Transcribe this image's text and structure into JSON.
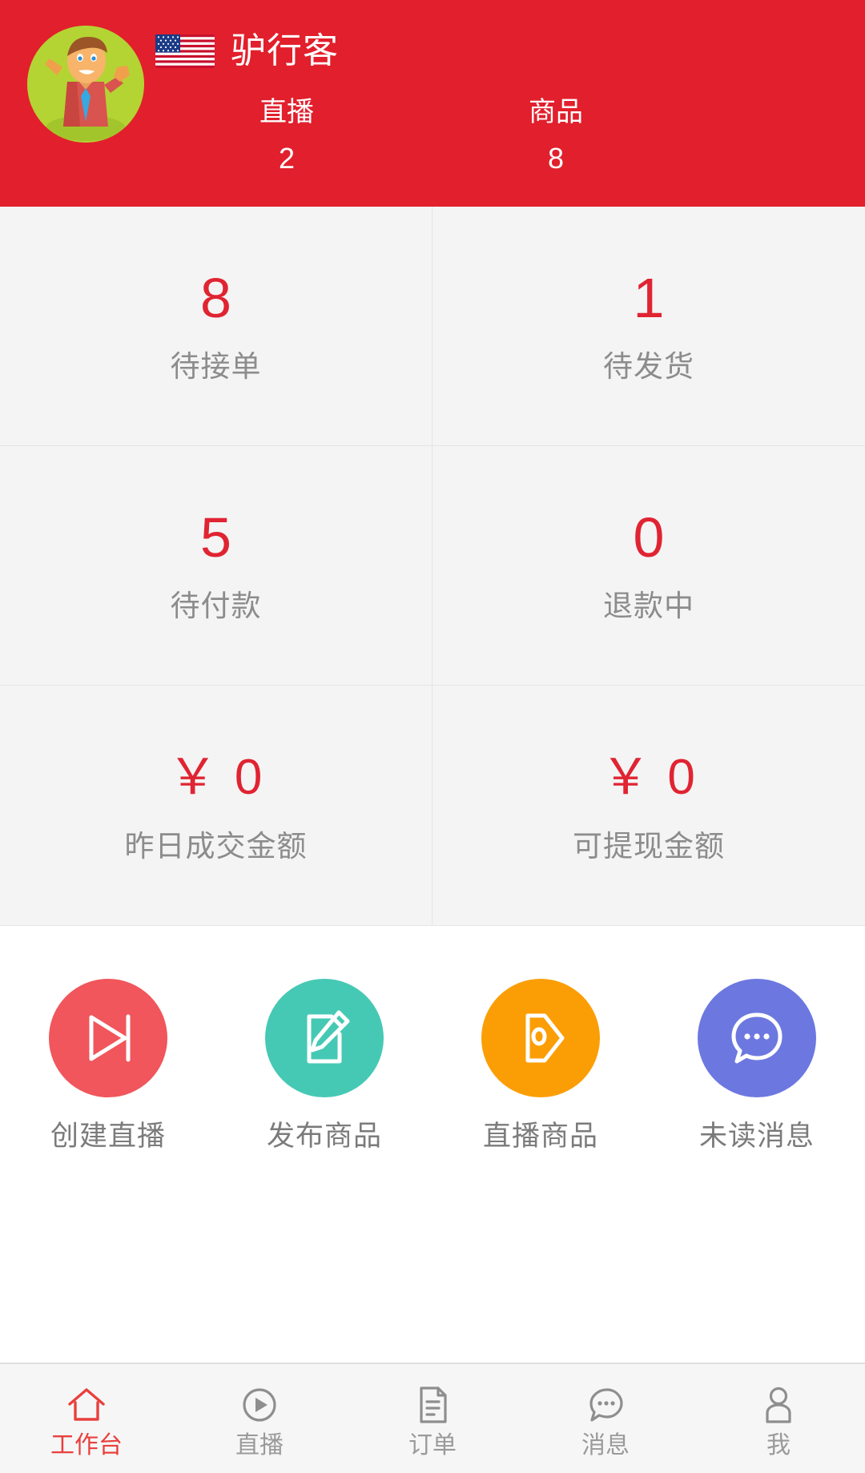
{
  "theme": {
    "brand_red": "#e21f2c",
    "value_red": "#e02432",
    "active_red": "#e8403e",
    "label_gray": "#8c8c8c",
    "panel_gray": "#f4f4f4",
    "tabbar_gray": "#f6f6f6"
  },
  "header": {
    "avatar_icon": "avatar-cartoon-man-icon",
    "flag_icon": "us-flag-icon",
    "shop_name": "驴行客",
    "stats": [
      {
        "label": "直播",
        "value": "2"
      },
      {
        "label": "商品",
        "value": "8"
      }
    ]
  },
  "stat_grid": [
    {
      "value": "8",
      "label": "待接单"
    },
    {
      "value": "1",
      "label": "待发货"
    },
    {
      "value": "5",
      "label": "待付款"
    },
    {
      "value": "0",
      "label": "退款中"
    },
    {
      "value": "￥ 0",
      "label": "昨日成交金额"
    },
    {
      "value": "￥ 0",
      "label": "可提现金额"
    }
  ],
  "actions": [
    {
      "label": "创建直播",
      "icon": "skip-next-play-icon",
      "color": "#f0565b"
    },
    {
      "label": "发布商品",
      "icon": "note-pencil-edit-icon",
      "color": "#46c9b4"
    },
    {
      "label": "直播商品",
      "icon": "price-tag-icon",
      "color": "#fb9e05"
    },
    {
      "label": "未读消息",
      "icon": "chat-bubble-dots-icon",
      "color": "#6c78e0"
    }
  ],
  "tabbar": [
    {
      "label": "工作台",
      "icon": "home-icon",
      "active": true
    },
    {
      "label": "直播",
      "icon": "play-circle-icon",
      "active": false
    },
    {
      "label": "订单",
      "icon": "document-icon",
      "active": false
    },
    {
      "label": "消息",
      "icon": "chat-bubble-icon",
      "active": false
    },
    {
      "label": "我",
      "icon": "user-person-icon",
      "active": false
    }
  ]
}
